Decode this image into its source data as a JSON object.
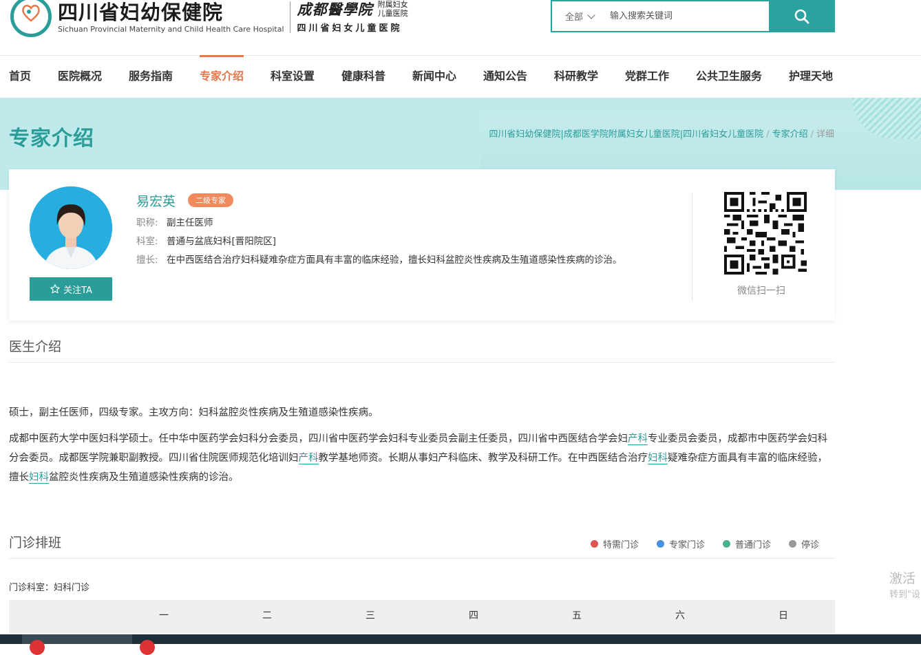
{
  "header": {
    "logo_cn": "四川省妇幼保健院",
    "logo_en": "Sichuan Provincial Maternity and Child  Health Care Hospital",
    "college_script": "成都醫學院",
    "college_affiliate": [
      "附属妇女",
      "儿童医院"
    ],
    "hospital_full": "四川省妇女儿童医院",
    "search": {
      "scope": "全部",
      "placeholder": "输入搜索关键词"
    }
  },
  "nav": [
    {
      "label": "首页",
      "active": false
    },
    {
      "label": "医院概况",
      "active": false
    },
    {
      "label": "服务指南",
      "active": false
    },
    {
      "label": "专家介绍",
      "active": true
    },
    {
      "label": "科室设置",
      "active": false
    },
    {
      "label": "健康科普",
      "active": false
    },
    {
      "label": "新闻中心",
      "active": false
    },
    {
      "label": "通知公告",
      "active": false
    },
    {
      "label": "科研教学",
      "active": false
    },
    {
      "label": "党群工作",
      "active": false
    },
    {
      "label": "公共卫生服务",
      "active": false
    },
    {
      "label": "护理天地",
      "active": false
    }
  ],
  "banner": {
    "title": "专家介绍",
    "breadcrumb": [
      "四川省妇幼保健院|成都医学院附属妇女儿童医院|四川省妇女儿童医院",
      "专家介绍",
      "详细"
    ]
  },
  "doctor": {
    "name": "易宏英",
    "level": "二级专家",
    "follow_label": "关注TA",
    "title_key": "职称:",
    "title_value": "副主任医师",
    "dept_key": "科室:",
    "dept_value": "普通与盆底妇科[晋阳院区]",
    "specialty_key": "擅长:",
    "specialty_value": "在中西医结合治疗妇科疑难杂症方面具有丰富的临床经验，擅长妇科盆腔炎性疾病及生殖道感染性疾病的诊治。",
    "qr_label": "微信扫一扫"
  },
  "intro": {
    "title": "医生介绍",
    "para1": "硕士，副主任医师，四级专家。主攻方向：妇科盆腔炎性疾病及生殖道感染性疾病。",
    "para2_parts": [
      {
        "text": "成都中医药大学中医妇科学硕士。任中华中医药学会妇科分会委员，四川省中医药学会妇科专业委员会副主任委员，四川省中西医结合学会妇",
        "link": false
      },
      {
        "text": "产科",
        "link": true
      },
      {
        "text": "专业委员会委员，成都市中医药学会妇科分会委员。成都医学院兼职副教授。四川省住院医师规范化培训妇",
        "link": false
      },
      {
        "text": "产科",
        "link": true
      },
      {
        "text": "教学基地师资。长期从事妇产科临床、教学及科研工作。在中西医结合治疗",
        "link": false
      },
      {
        "text": "妇科",
        "link": true
      },
      {
        "text": "疑难杂症方面具有丰富的临床经验，擅长",
        "link": false
      },
      {
        "text": "妇科",
        "link": true
      },
      {
        "text": "盆腔炎性疾病及生殖道感染性疾病的诊治。",
        "link": false
      }
    ]
  },
  "schedule": {
    "title": "门诊排班",
    "legend": [
      {
        "label": "特需门诊",
        "color": "#e05353"
      },
      {
        "label": "专家门诊",
        "color": "#4a90e2"
      },
      {
        "label": "普通门诊",
        "color": "#4cb08a"
      },
      {
        "label": "停诊",
        "color": "#999999"
      }
    ],
    "dept_label": "门诊科室：妇科门诊",
    "weekdays": [
      "一",
      "二",
      "三",
      "四",
      "五",
      "六",
      "日"
    ]
  },
  "watermark": {
    "line1": "激活",
    "line2": "转到\"设"
  },
  "colors": {
    "brand": "#2a9d99",
    "accent": "#e5774a",
    "badge": "#f08a5d"
  }
}
